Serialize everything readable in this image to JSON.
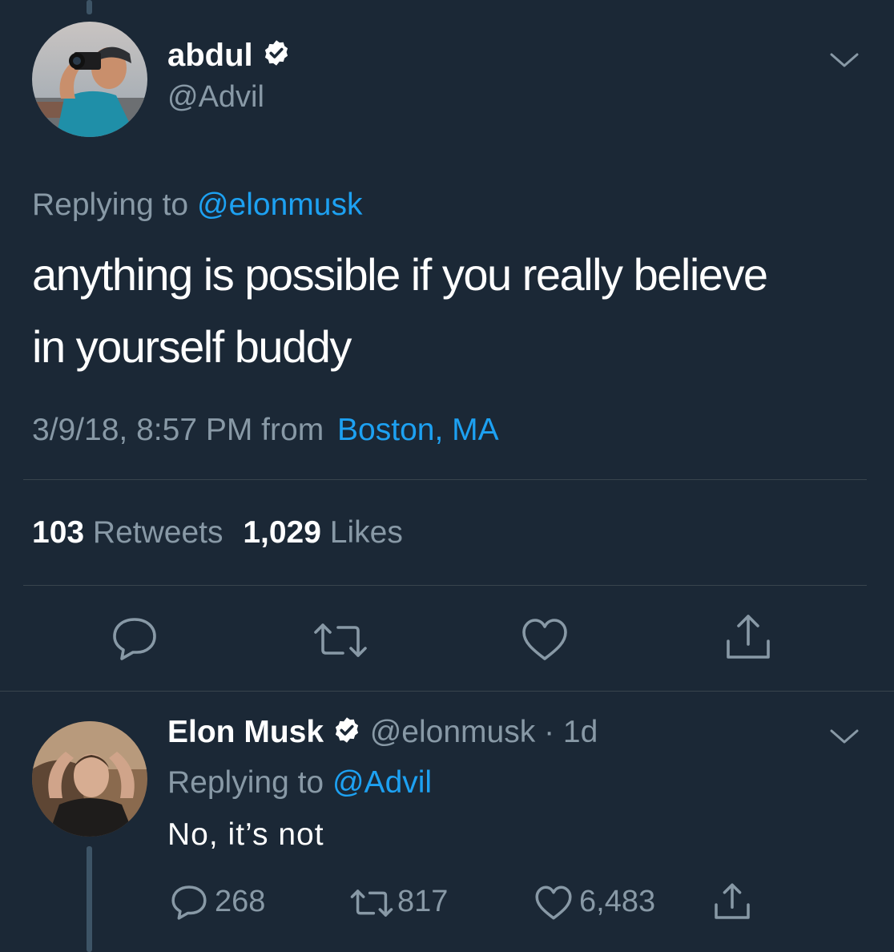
{
  "main_tweet": {
    "display_name": "abdul",
    "handle": "@Advil",
    "replying_prefix": "Replying to",
    "replying_to": "@elonmusk",
    "text_line1": "anything is possible if you really believe",
    "text_line2": "in yourself buddy",
    "timestamp": "3/9/18, 8:57 PM from",
    "location": "Boston, MA",
    "retweets_count": "103",
    "retweets_label": "Retweets",
    "likes_count": "1,029",
    "likes_label": "Likes"
  },
  "reply_tweet": {
    "display_name": "Elon Musk",
    "handle": "@elonmusk",
    "separator": "·",
    "age": "1d",
    "replying_prefix": "Replying to",
    "replying_to": "@Advil",
    "text": "No, it’s not",
    "reply_count": "268",
    "retweet_count": "817",
    "like_count": "6,483"
  },
  "colors": {
    "background": "#1b2836",
    "accent": "#1da1f2",
    "muted": "#8899a6",
    "divider": "#38444d"
  },
  "icons": [
    "verified-badge-icon",
    "chevron-down-icon",
    "reply-icon",
    "retweet-icon",
    "like-icon",
    "share-icon"
  ]
}
